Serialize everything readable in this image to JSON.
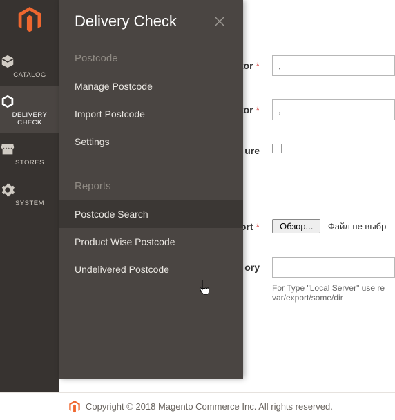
{
  "rail": {
    "items": [
      {
        "label": "CATALOG"
      },
      {
        "label": "DELIVERY CHECK"
      },
      {
        "label": "STORES"
      },
      {
        "label": "SYSTEM"
      }
    ]
  },
  "flyout": {
    "title": "Delivery Check",
    "sections": [
      {
        "label": "Postcode",
        "items": [
          {
            "label": "Manage Postcode"
          },
          {
            "label": "Import Postcode"
          },
          {
            "label": "Settings"
          }
        ]
      },
      {
        "label": "Reports",
        "items": [
          {
            "label": "Postcode Search"
          },
          {
            "label": "Product Wise Postcode"
          },
          {
            "label": "Undelivered Postcode"
          }
        ]
      }
    ]
  },
  "form": {
    "rows": [
      {
        "label_suffix": "tor",
        "required": true,
        "type": "text",
        "value": ","
      },
      {
        "label_suffix": "tor",
        "required": true,
        "type": "text",
        "value": ","
      },
      {
        "label_suffix": "ure",
        "required": false,
        "type": "checkbox"
      },
      {
        "label_suffix": "ort",
        "required": true,
        "type": "file",
        "button": "Обзор...",
        "file_text": "Файл не выбр"
      },
      {
        "label_suffix": "ory",
        "required": false,
        "type": "text",
        "value": ""
      }
    ],
    "help_text": "For Type \"Local Server\" use re\nvar/export/some/dir"
  },
  "footer": {
    "text": "Copyright © 2018 Magento Commerce Inc. All rights reserved."
  }
}
